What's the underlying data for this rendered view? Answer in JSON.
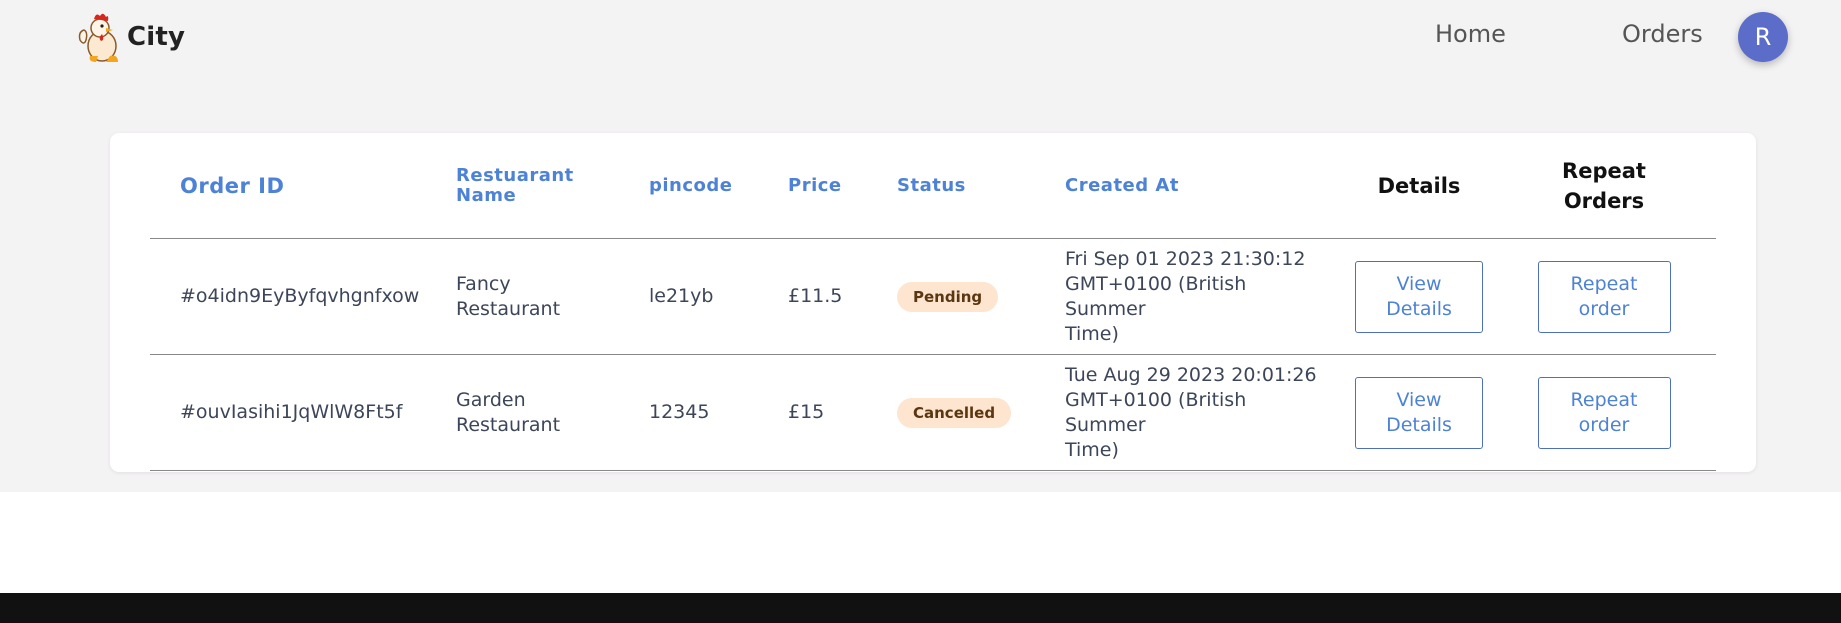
{
  "brand": {
    "name": "City"
  },
  "nav": {
    "home": "Home",
    "orders": "Orders",
    "avatar_initial": "R"
  },
  "table": {
    "headers": {
      "order_id": "Order ID",
      "restaurant_line1": "Restuarant",
      "restaurant_line2": "Name",
      "pincode": "pincode",
      "price": "Price",
      "status": "Status",
      "created_at": "Created At",
      "details": "Details",
      "repeat_line1": "Repeat",
      "repeat_line2": "Orders"
    },
    "rows": [
      {
        "order_id": "#o4idn9EyByfqvhgnfxow",
        "restaurant_line1": "Fancy",
        "restaurant_line2": "Restaurant",
        "pincode": "le21yb",
        "price": "£11.5",
        "status": "Pending",
        "created_line1": "Fri Sep 01 2023 21:30:12",
        "created_line2": "GMT+0100 (British Summer",
        "created_line3": "Time)",
        "details_line1": "View",
        "details_line2": "Details",
        "repeat_line1": "Repeat",
        "repeat_line2": "order"
      },
      {
        "order_id": "#ouvIasihi1JqWlW8Ft5f",
        "restaurant_line1": "Garden",
        "restaurant_line2": "Restaurant",
        "pincode": "12345",
        "price": "£15",
        "status": "Cancelled",
        "created_line1": "Tue Aug 29 2023 20:01:26",
        "created_line2": "GMT+0100 (British Summer",
        "created_line3": "Time)",
        "details_line1": "View",
        "details_line2": "Details",
        "repeat_line1": "Repeat",
        "repeat_line2": "order"
      }
    ]
  },
  "colors": {
    "accent": "#4d82d6",
    "avatar": "#5b6cc9",
    "badge_bg": "#fde5cf",
    "footer": "#111111"
  },
  "icons": {
    "logo": "rooster-chef-logo-icon"
  }
}
